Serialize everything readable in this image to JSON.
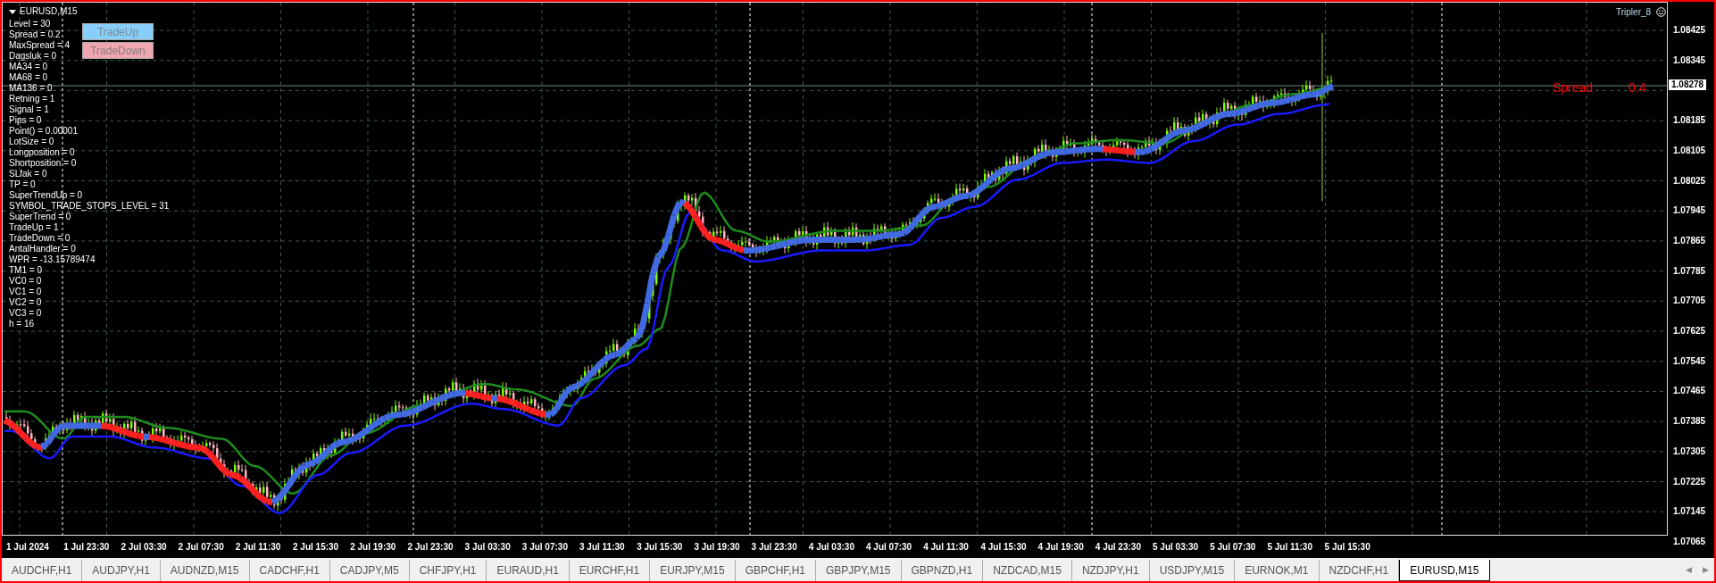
{
  "chart": {
    "symbol": "EURUSD,M15",
    "expert": "Tripler_8",
    "info_lines": [
      "Level = 30",
      "Spread = 0.2",
      "MaxSpread = 4",
      "Dagsluk = 0",
      "MA34 = 0",
      "MA68 = 0",
      "MA136 = 0",
      "Retning = 1",
      "Signal = 1",
      "Pips = 0",
      "Point() = 0.00001",
      "LotSize = 0",
      "Longposition = 0",
      "Shortposition = 0",
      "SLfak = 0",
      "TP = 0",
      "SuperTrendUp = 0",
      "SYMBOL_TRADE_STOPS_LEVEL = 31",
      "SuperTrend = 0",
      "TradeUp = 1",
      "TradeDown = 0",
      "AntalHandler = 0",
      "WPR = -13.15789474",
      "TM1 = 0",
      "VC0 = 0",
      "VC1 = 0",
      "VC2 = 0",
      "VC3 = 0",
      "h = 16"
    ],
    "buttons": [
      {
        "label": "TradeUp",
        "kind": "up"
      },
      {
        "label": "TradeDown",
        "kind": "down"
      }
    ],
    "spread_label": "Spread",
    "spread_value": "0.4",
    "current_price": "1.08278",
    "price_axis": [
      "1.08425",
      "1.08345",
      "1.08185",
      "1.08105",
      "1.08025",
      "1.07945",
      "1.07865",
      "1.07785",
      "1.07705",
      "1.07625",
      "1.07545",
      "1.07465",
      "1.07385",
      "1.07305",
      "1.07225",
      "1.07145",
      "1.07065"
    ],
    "time_axis": [
      "1 Jul 2024",
      "1 Jul 23:30",
      "2 Jul 03:30",
      "2 Jul 07:30",
      "2 Jul 11:30",
      "2 Jul 15:30",
      "2 Jul 19:30",
      "2 Jul 23:30",
      "3 Jul 03:30",
      "3 Jul 07:30",
      "3 Jul 11:30",
      "3 Jul 15:30",
      "3 Jul 19:30",
      "3 Jul 23:30",
      "4 Jul 03:30",
      "4 Jul 07:30",
      "4 Jul 11:30",
      "4 Jul 15:30",
      "4 Jul 19:30",
      "4 Jul 23:30",
      "5 Jul 03:30",
      "5 Jul 07:30",
      "5 Jul 11:30",
      "5 Jul 15:30"
    ]
  },
  "tabs": [
    {
      "label": "AUDCHF,H1",
      "selected": false
    },
    {
      "label": "AUDJPY,H1",
      "selected": false
    },
    {
      "label": "AUDNZD,M15",
      "selected": false
    },
    {
      "label": "CADCHF,H1",
      "selected": false
    },
    {
      "label": "CADJPY,M5",
      "selected": false
    },
    {
      "label": "CHFJPY,H1",
      "selected": false
    },
    {
      "label": "EURAUD,H1",
      "selected": false
    },
    {
      "label": "EURCHF,H1",
      "selected": false
    },
    {
      "label": "EURJPY,M15",
      "selected": false
    },
    {
      "label": "GBPCHF,H1",
      "selected": false
    },
    {
      "label": "GBPJPY,M15",
      "selected": false
    },
    {
      "label": "GBPNZD,H1",
      "selected": false
    },
    {
      "label": "NZDCAD,M15",
      "selected": false
    },
    {
      "label": "NZDJPY,H1",
      "selected": false
    },
    {
      "label": "USDJPY,M15",
      "selected": false
    },
    {
      "label": "EURNOK,M1",
      "selected": false
    },
    {
      "label": "NZDCHF,H1",
      "selected": false
    },
    {
      "label": "EURUSD,M15",
      "selected": true
    }
  ],
  "tab_scroll": [
    "◀",
    "▶"
  ]
}
